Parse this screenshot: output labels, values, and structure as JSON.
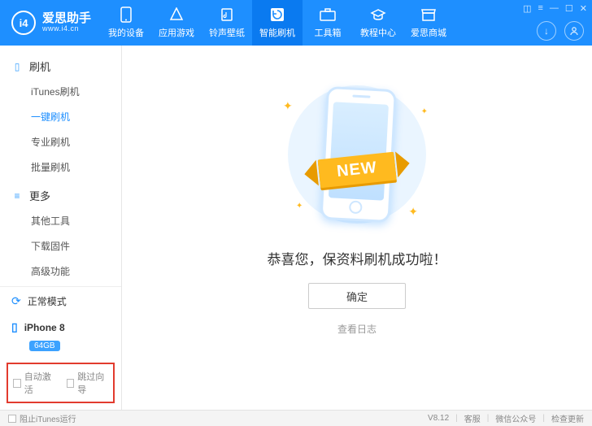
{
  "app": {
    "name_cn": "爱思助手",
    "name_en": "www.i4.cn"
  },
  "nav": [
    {
      "id": "devices",
      "label": "我的设备"
    },
    {
      "id": "apps",
      "label": "应用游戏"
    },
    {
      "id": "ringtone",
      "label": "铃声壁纸"
    },
    {
      "id": "flash",
      "label": "智能刷机"
    },
    {
      "id": "toolbox",
      "label": "工具箱"
    },
    {
      "id": "tutorial",
      "label": "教程中心"
    },
    {
      "id": "mall",
      "label": "爱思商城"
    }
  ],
  "sidebar": {
    "group1": {
      "title": "刷机",
      "items": [
        {
          "id": "itunes",
          "label": "iTunes刷机"
        },
        {
          "id": "oneclick",
          "label": "一键刷机"
        },
        {
          "id": "pro",
          "label": "专业刷机"
        },
        {
          "id": "batch",
          "label": "批量刷机"
        }
      ]
    },
    "group2": {
      "title": "更多",
      "items": [
        {
          "id": "other",
          "label": "其他工具"
        },
        {
          "id": "firmware",
          "label": "下载固件"
        },
        {
          "id": "advanced",
          "label": "高级功能"
        }
      ]
    },
    "mode": "正常模式",
    "device": "iPhone 8",
    "storage": "64GB",
    "options": {
      "auto_activate": "自动激活",
      "skip_guide": "跳过向导"
    }
  },
  "main": {
    "ribbon": "NEW",
    "message": "恭喜您，保资料刷机成功啦！",
    "confirm": "确定",
    "view_log": "查看日志"
  },
  "status": {
    "block_itunes": "阻止iTunes运行",
    "version": "V8.12",
    "support": "客服",
    "wechat": "微信公众号",
    "update": "检查更新"
  }
}
